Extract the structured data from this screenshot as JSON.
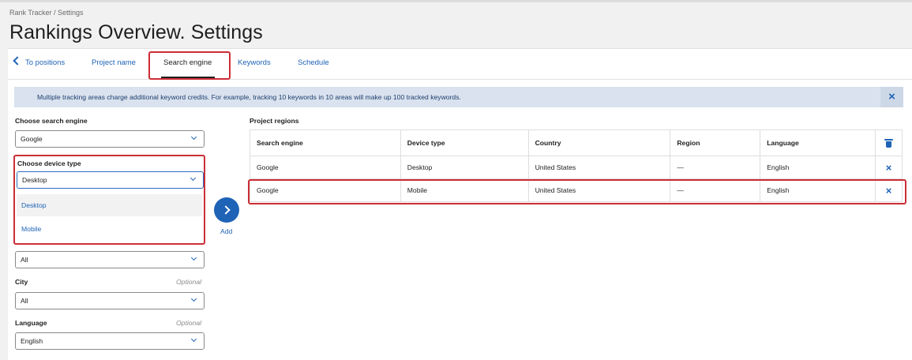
{
  "breadcrumb": "Rank Tracker / Settings",
  "title": "Rankings Overview. Settings",
  "tabs": {
    "back": "To positions",
    "project_name": "Project name",
    "search_engine": "Search engine",
    "keywords": "Keywords",
    "schedule": "Schedule",
    "active": "Search engine"
  },
  "banner": {
    "text": "Multiple tracking areas charge additional keyword credits. For example, tracking 10 keywords in 10 areas will make up 100 tracked keywords.",
    "close_icon": "close-icon"
  },
  "form": {
    "engine_label": "Choose search engine",
    "engine_value": "Google",
    "device_label": "Choose device type",
    "device_value": "Desktop",
    "device_options": [
      "Desktop",
      "Mobile"
    ],
    "region_value": "All",
    "city_label": "City",
    "city_optional": "Optional",
    "city_value": "All",
    "language_label": "Language",
    "language_optional": "Optional",
    "language_value": "English"
  },
  "add": {
    "label": "Add"
  },
  "regions": {
    "title": "Project regions",
    "columns": [
      "Search engine",
      "Device type",
      "Country",
      "Region",
      "Language"
    ],
    "rows": [
      {
        "engine": "Google",
        "device": "Desktop",
        "country": "United States",
        "region": "—",
        "language": "English"
      },
      {
        "engine": "Google",
        "device": "Mobile",
        "country": "United States",
        "region": "—",
        "language": "English"
      }
    ]
  },
  "icons": {
    "remove": "×"
  },
  "colors": {
    "accent": "#1e63b6",
    "highlight": "#cc2d35",
    "banner_bg": "#d9e2ee"
  }
}
